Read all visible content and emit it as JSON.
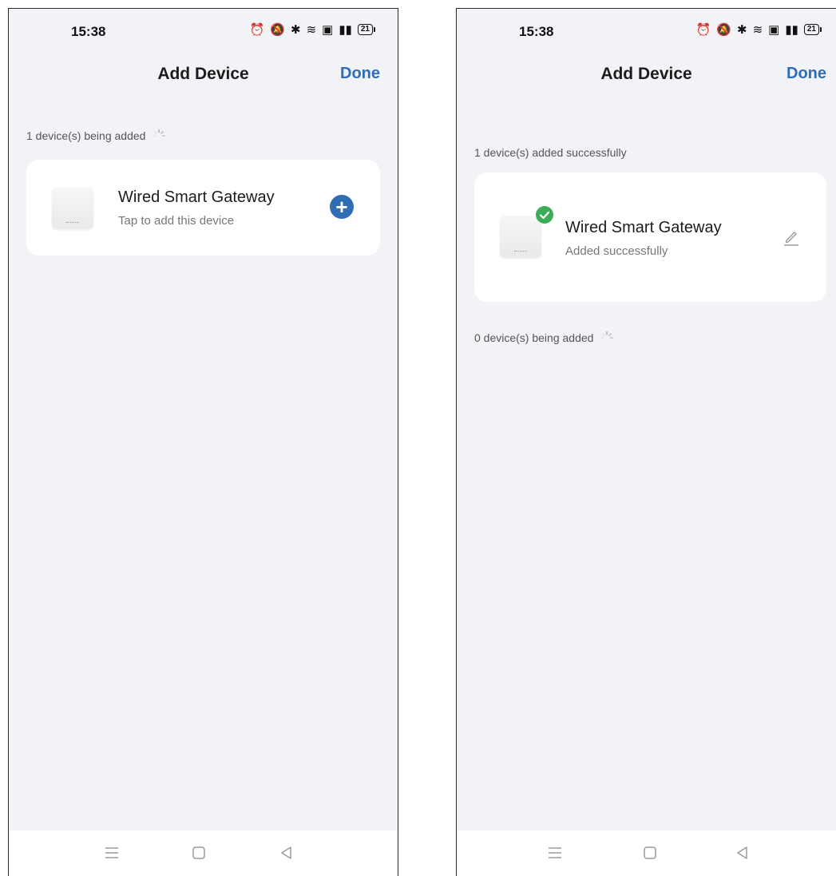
{
  "status": {
    "time": "15:38",
    "battery": "21"
  },
  "left": {
    "title": "Add Device",
    "done_label": "Done",
    "section_label": "1 device(s) being added",
    "device": {
      "name": "Wired Smart Gateway",
      "subtitle": "Tap to add this device",
      "action_icon": "plus-circle-icon"
    }
  },
  "right": {
    "title": "Add Device",
    "done_label": "Done",
    "section_label_added": "1 device(s) added successfully",
    "device": {
      "name": "Wired Smart Gateway",
      "subtitle": "Added successfully",
      "badge_icon": "check-circle-icon",
      "action_icon": "pencil-icon"
    },
    "section_label_pending": "0 device(s) being added"
  },
  "nav": {
    "icons": [
      "menu-icon",
      "home-square-icon",
      "back-triangle-icon"
    ]
  },
  "colors": {
    "accent": "#2f6db5",
    "success": "#3cae5a",
    "background": "#f2f3f7",
    "card": "#ffffff"
  }
}
